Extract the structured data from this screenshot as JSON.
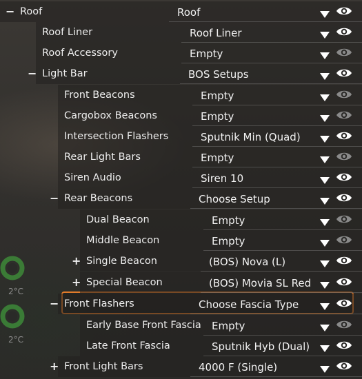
{
  "rows": [
    {
      "label": "Roof",
      "value": "Roof",
      "expand": "minus",
      "eye": "on"
    },
    {
      "label": "Roof Liner",
      "value": "Roof Liner",
      "expand": "",
      "eye": "on"
    },
    {
      "label": "Roof Accessory",
      "value": "Empty",
      "expand": "",
      "eye": "off"
    },
    {
      "label": "Light Bar",
      "value": "BOS Setups",
      "expand": "minus",
      "eye": "on"
    },
    {
      "label": "Front Beacons",
      "value": "Empty",
      "expand": "",
      "eye": "off"
    },
    {
      "label": "Cargobox Beacons",
      "value": "Empty",
      "expand": "",
      "eye": "off"
    },
    {
      "label": "Intersection Flashers",
      "value": "Sputnik Min (Quad)",
      "expand": "",
      "eye": "on"
    },
    {
      "label": "Rear Light Bars",
      "value": "Empty",
      "expand": "",
      "eye": "off"
    },
    {
      "label": "Siren Audio",
      "value": "Siren 10",
      "expand": "",
      "eye": "on"
    },
    {
      "label": "Rear Beacons",
      "value": "Choose Setup",
      "expand": "minus",
      "eye": "on"
    },
    {
      "label": "Dual Beacon",
      "value": "Empty",
      "expand": "",
      "eye": "off"
    },
    {
      "label": "Middle Beacon",
      "value": "Empty",
      "expand": "",
      "eye": "off"
    },
    {
      "label": "Single Beacon",
      "value": "(BOS) Nova (L)",
      "expand": "plus",
      "eye": "on"
    },
    {
      "label": "Special Beacon",
      "value": "(BOS) Movia SL Red",
      "expand": "plus",
      "eye": "on"
    },
    {
      "label": "Front Flashers",
      "value": "Choose Fascia Type",
      "expand": "minus",
      "eye": "on"
    },
    {
      "label": "Early Base Front Fascia",
      "value": "Empty",
      "expand": "",
      "eye": "off"
    },
    {
      "label": "Late Front Fascia",
      "value": "Sputnik Hyb (Dual)",
      "expand": "",
      "eye": "on"
    },
    {
      "label": "Front Light Bars",
      "value": "4000 F (Single)",
      "expand": "plus",
      "eye": "on"
    }
  ],
  "side_gauges": [
    {
      "temp": "2°C"
    },
    {
      "temp": "2°C"
    }
  ],
  "colors": {
    "accent_outline": "#e07a2a",
    "gauge_green": "#3f8f3a",
    "eye_on": "#ffffff",
    "eye_off": "#8a8a8a"
  }
}
